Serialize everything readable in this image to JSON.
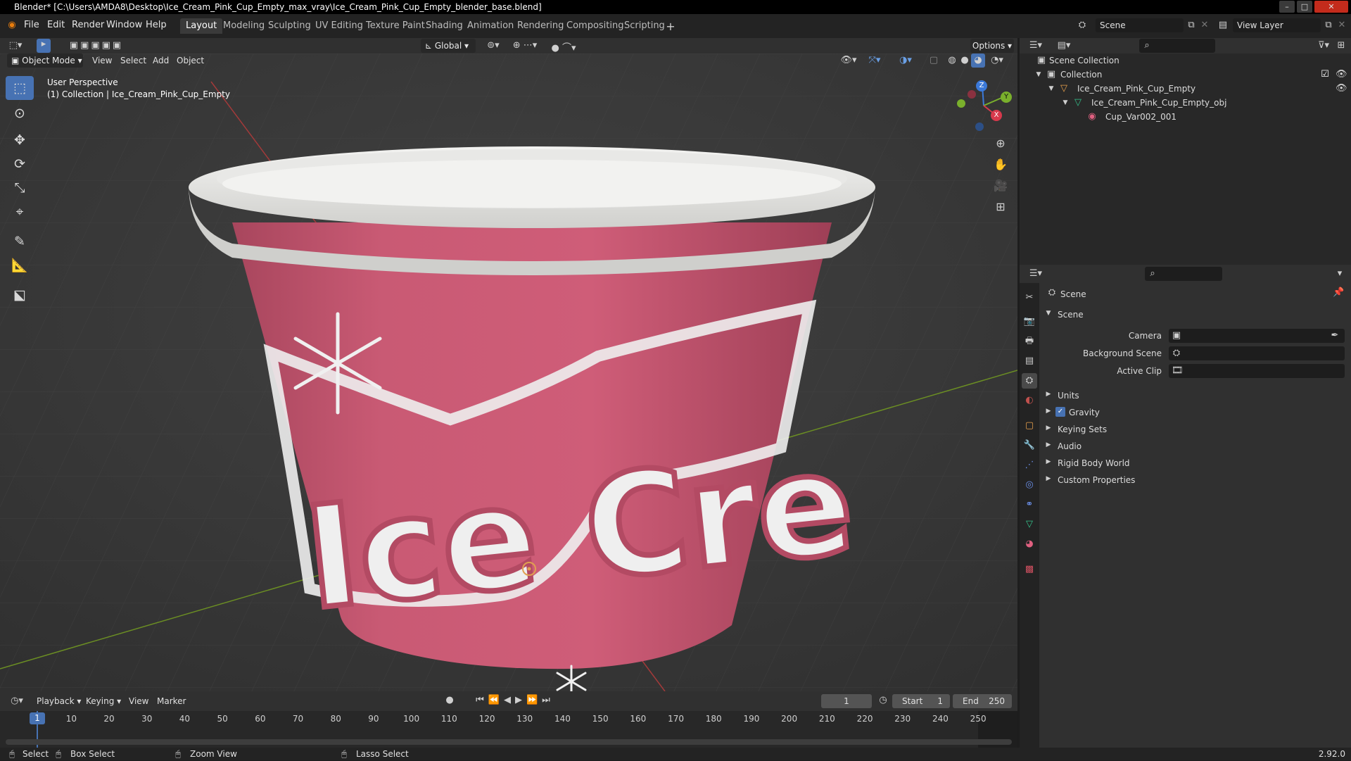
{
  "window": {
    "title": "Blender* [C:\\Users\\AMDA8\\Desktop\\Ice_Cream_Pink_Cup_Empty_max_vray\\Ice_Cream_Pink_Cup_Empty_blender_base.blend]"
  },
  "menu": [
    "File",
    "Edit",
    "Render",
    "Window",
    "Help"
  ],
  "workspaces": [
    "Layout",
    "Modeling",
    "Sculpting",
    "UV Editing",
    "Texture Paint",
    "Shading",
    "Animation",
    "Rendering",
    "Compositing",
    "Scripting"
  ],
  "topbar": {
    "scene": "Scene",
    "view_layer": "View Layer"
  },
  "viewport": {
    "transform_orientation": "Global",
    "options_label": "Options",
    "mode": "Object Mode",
    "menus": [
      "View",
      "Select",
      "Add",
      "Object"
    ],
    "overlay_line1": "User Perspective",
    "overlay_line2": "(1) Collection | Ice_Cream_Pink_Cup_Empty",
    "gizmo": {
      "z": "Z",
      "y": "Y",
      "x": "X"
    },
    "cup_text": "Ice Cre"
  },
  "outliner": {
    "rows": [
      "Scene Collection",
      "Collection",
      "Ice_Cream_Pink_Cup_Empty",
      "Ice_Cream_Pink_Cup_Empty_obj",
      "Cup_Var002_001"
    ]
  },
  "properties": {
    "context": "Scene",
    "panel": "Scene",
    "camera_label": "Camera",
    "bg_scene_label": "Background Scene",
    "active_clip_label": "Active Clip",
    "subpanels": [
      "Units",
      "Gravity",
      "Keying Sets",
      "Audio",
      "Rigid Body World",
      "Custom Properties"
    ],
    "gravity_checked": true
  },
  "timeline": {
    "menus": [
      "Playback",
      "Keying",
      "View",
      "Marker"
    ],
    "current_frame": "1",
    "start_label": "Start",
    "start": "1",
    "end_label": "End",
    "end": "250",
    "ticks": [
      "1",
      "10",
      "20",
      "30",
      "40",
      "50",
      "60",
      "70",
      "80",
      "90",
      "100",
      "110",
      "120",
      "130",
      "140",
      "150",
      "160",
      "170",
      "180",
      "190",
      "200",
      "210",
      "220",
      "230",
      "240",
      "250"
    ]
  },
  "statusbar": {
    "select": "Select",
    "box_select": "Box Select",
    "zoom_view": "Zoom View",
    "lasso_select": "Lasso Select",
    "version": "2.92.0"
  },
  "colors": {
    "accent": "#4772b3",
    "cup_pink": "#c5546f",
    "cup_rim": "#e6e6e3"
  }
}
